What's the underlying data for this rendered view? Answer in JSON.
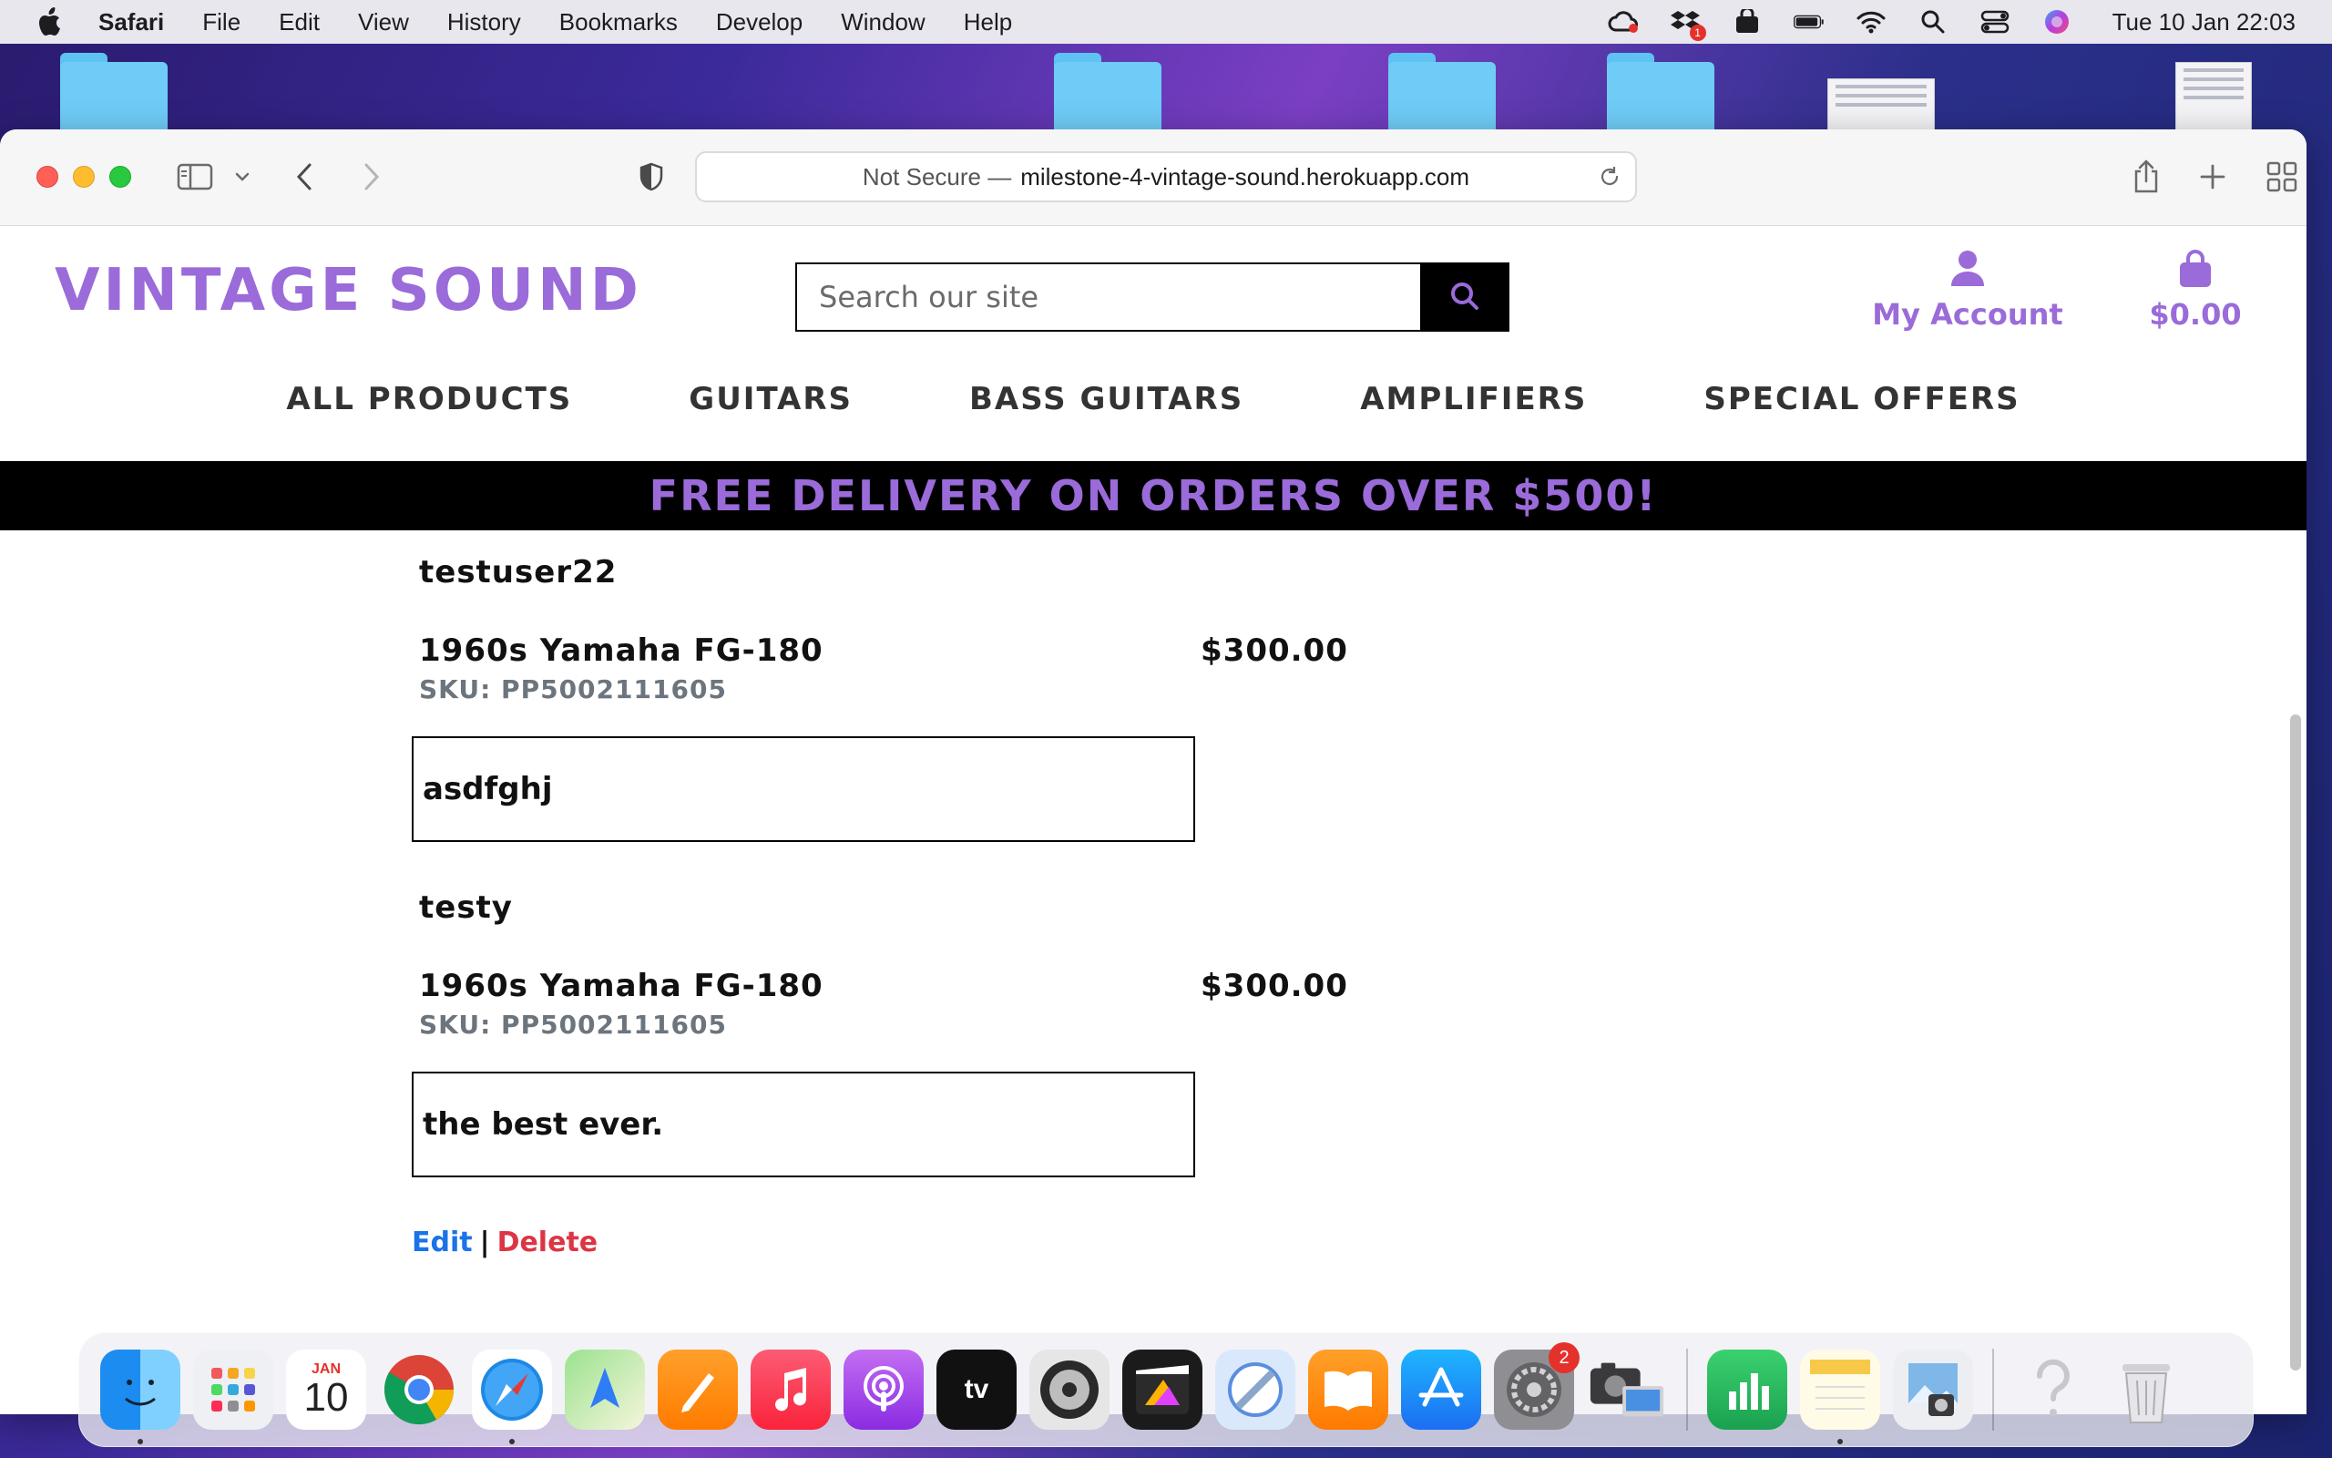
{
  "menubar": {
    "app_name": "Safari",
    "items": [
      "File",
      "Edit",
      "View",
      "History",
      "Bookmarks",
      "Develop",
      "Window",
      "Help"
    ],
    "status_badge": "1",
    "clock": "Tue 10 Jan  22:03"
  },
  "browser": {
    "url_prefix": "Not Secure —",
    "url_host": "milestone-4-vintage-sound.herokuapp.com"
  },
  "site": {
    "logo": "VINTAGE SOUND",
    "search_placeholder": "Search our site",
    "account_label": "My Account",
    "cart_total": "$0.00",
    "brand_color": "#9a6bd9",
    "nav": [
      "ALL PRODUCTS",
      "GUITARS",
      "BASS GUITARS",
      "AMPLIFIERS",
      "SPECIAL OFFERS"
    ],
    "banner": "FREE DELIVERY ON ORDERS OVER $500!"
  },
  "reviews": [
    {
      "user": "testuser22",
      "product": "1960s Yamaha FG-180",
      "price": "$300.00",
      "sku": "SKU: PP5002111605",
      "text": "asdfghj"
    },
    {
      "user": "testy",
      "product": "1960s Yamaha FG-180",
      "price": "$300.00",
      "sku": "SKU: PP5002111605",
      "text": "the best ever."
    }
  ],
  "actions": {
    "edit": "Edit",
    "separator": "|",
    "delete": "Delete"
  },
  "dock": {
    "calendar_month": "JAN",
    "calendar_day": "10",
    "tv_label": "tv",
    "settings_badge": "2"
  }
}
